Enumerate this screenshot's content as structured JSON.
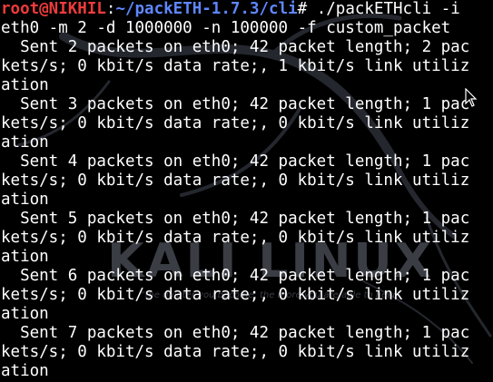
{
  "terminal": {
    "prompt": {
      "user_host": "root@NIKHIL",
      "separator": ":",
      "path": "~/packETH-1.7.3/cli",
      "symbol": "#"
    },
    "command_first": " ./packETHcli -i",
    "command_wrap": "eth0 -m 2 -d 1000000 -n 100000 -f custom_packet",
    "output": [
      {
        "line1": "  Sent 2 packets on eth0; 42 packet length; 2 pac",
        "line2": "kets/s; 0 kbit/s data rate;, 1 kbit/s link utiliz",
        "line3": "ation"
      },
      {
        "line1": "  Sent 3 packets on eth0; 42 packet length; 1 pac",
        "line2": "kets/s; 0 kbit/s data rate;, 0 kbit/s link utiliz",
        "line3": "ation"
      },
      {
        "line1": "  Sent 4 packets on eth0; 42 packet length; 1 pac",
        "line2": "kets/s; 0 kbit/s data rate;, 0 kbit/s link utiliz",
        "line3": "ation"
      },
      {
        "line1": "  Sent 5 packets on eth0; 42 packet length; 1 pac",
        "line2": "kets/s; 0 kbit/s data rate;, 0 kbit/s link utiliz",
        "line3": "ation"
      },
      {
        "line1": "  Sent 6 packets on eth0; 42 packet length; 1 pac",
        "line2": "kets/s; 0 kbit/s data rate;, 0 kbit/s link utiliz",
        "line3": "ation"
      },
      {
        "line1": "  Sent 7 packets on eth0; 42 packet length; 1 pac",
        "line2": "kets/s; 0 kbit/s data rate;, 0 kbit/s link utiliz",
        "line3": "ation"
      }
    ],
    "colors": {
      "background": "#000000",
      "text": "#ffffff",
      "user_host": "#ee3b3b",
      "path": "#5f87ff"
    }
  },
  "wallpaper": {
    "logo_text": "KALI LINUX",
    "tagline": "“the quieter you become, the more you are able to hear”"
  },
  "icons": {
    "pointer": "mouse-pointer-icon",
    "dragon": "kali-dragon-icon"
  }
}
